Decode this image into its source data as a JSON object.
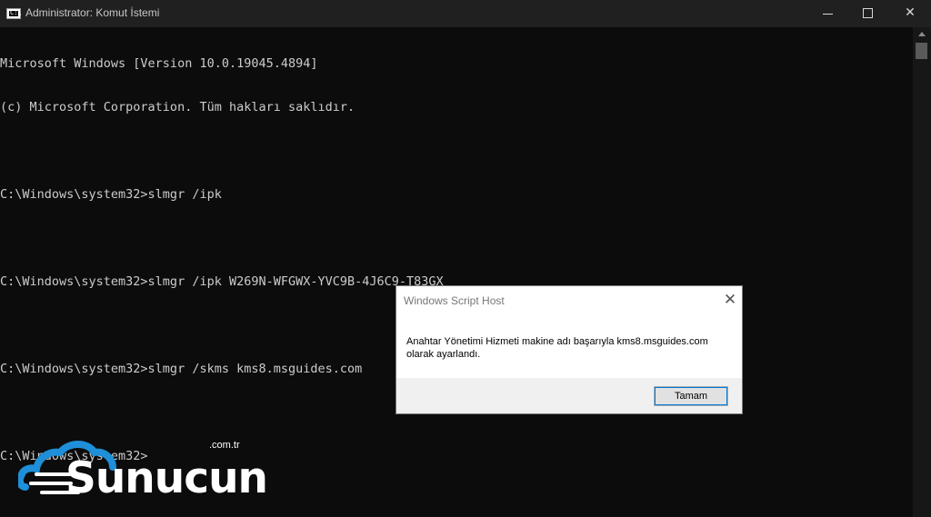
{
  "window": {
    "title": "Administrator: Komut İstemi",
    "icon": "cmd-icon",
    "icon_glyph": "C:\\"
  },
  "console": {
    "lines": [
      "Microsoft Windows [Version 10.0.19045.4894]",
      "(c) Microsoft Corporation. Tüm hakları saklıdır.",
      "",
      "C:\\Windows\\system32>slmgr /ipk",
      "",
      "C:\\Windows\\system32>slmgr /ipk W269N-WFGWX-YVC9B-4J6C9-T83GX",
      "",
      "C:\\Windows\\system32>slmgr /skms kms8.msguides.com",
      "",
      "C:\\Windows\\system32>"
    ],
    "colors": {
      "background": "#0c0c0c",
      "text": "#cccccc"
    }
  },
  "dialog": {
    "title": "Windows Script Host",
    "message_line1": "Anahtar Yönetimi Hizmeti makine adı başarıyla kms8.msguides.com",
    "message_line2": "olarak ayarlandı.",
    "ok_label": "Tamam",
    "accent": "#0078d7"
  },
  "logo": {
    "name": "Sunucun",
    "tld": ".com.tr",
    "color": "#1e8fd8"
  }
}
